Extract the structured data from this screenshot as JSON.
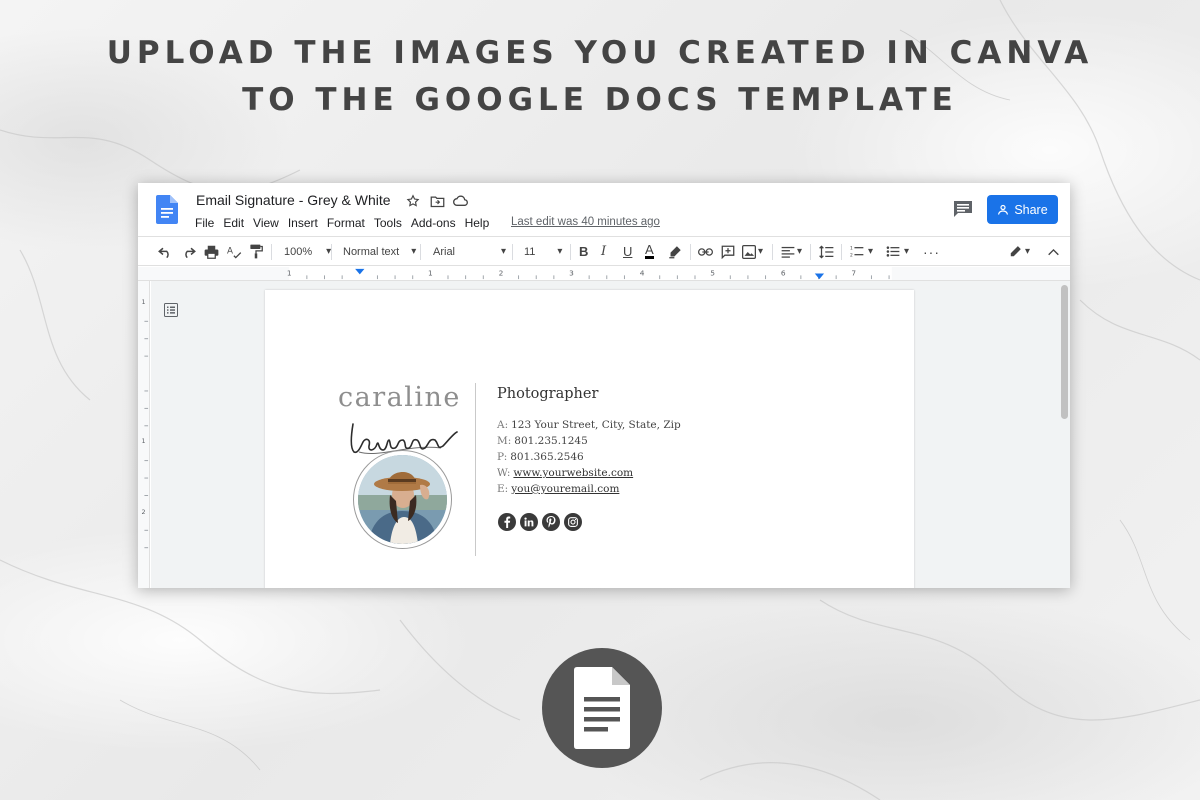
{
  "headline": {
    "line1": "UPLOAD THE IMAGES YOU CREATED IN CANVA",
    "line2": "TO THE GOOGLE DOCS TEMPLATE"
  },
  "doc": {
    "title": "Email Signature - Grey & White",
    "menu": [
      "File",
      "Edit",
      "View",
      "Insert",
      "Format",
      "Tools",
      "Add-ons",
      "Help"
    ],
    "last_edit": "Last edit was 40 minutes ago",
    "share_label": "Share"
  },
  "toolbar": {
    "zoom": "100%",
    "style": "Normal text",
    "font": "Arial",
    "size": "11",
    "bold_label": "B",
    "italic_label": "I",
    "underline_label": "U",
    "color_label": "A"
  },
  "ruler": {
    "ticks": [
      "1",
      "1",
      "2",
      "3",
      "4",
      "5",
      "6",
      "7"
    ],
    "side_ticks": [
      "1",
      "1",
      "2"
    ]
  },
  "signature": {
    "first_name": "caraline",
    "last_name": "larson",
    "role": "Photographer",
    "lines": [
      {
        "key": "A:",
        "value": "123 Your Street, City, State, Zip",
        "link": false
      },
      {
        "key": "M:",
        "value": "801.235.1245",
        "link": false
      },
      {
        "key": "P:",
        "value": "801.365.2546",
        "link": false
      },
      {
        "key": "W:",
        "value": "www.yourwebsite.com",
        "link": true
      },
      {
        "key": "E:",
        "value": "you@youremail.com",
        "link": true
      }
    ],
    "socials": [
      "facebook-icon",
      "linkedin-icon",
      "pinterest-icon",
      "instagram-icon"
    ]
  },
  "colors": {
    "share": "#1a73e8",
    "docs_blue": "#4285f4",
    "icon_circle": "#555555"
  }
}
